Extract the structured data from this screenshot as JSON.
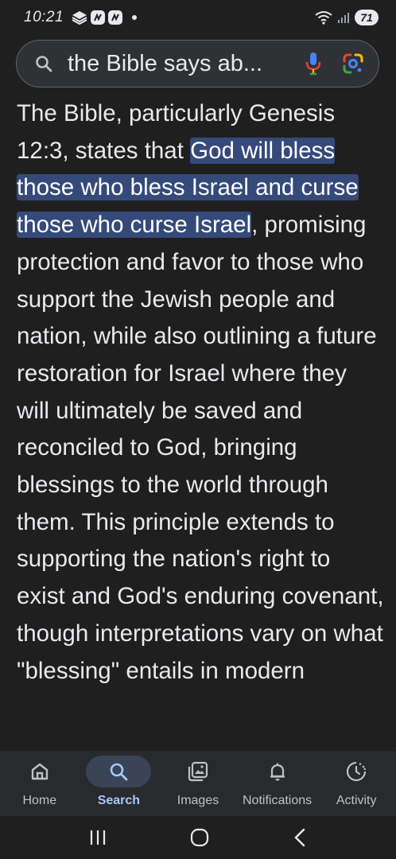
{
  "status_bar": {
    "time": "10:21",
    "battery": "71"
  },
  "search": {
    "query": "the Bible says ab..."
  },
  "answer": {
    "before": "The Bible, particularly Genesis 12:3, states that ",
    "highlight": "God will bless those who bless Israel and curse those who curse Israel",
    "after": ", promising protection and favor to those who support the Jewish people and nation, while also outlining a future restoration for Israel where they will ultimately be saved and reconciled to God, bringing blessings to the world through them. This principle extends to supporting the nation's right to exist and God's enduring covenant, though interpretations vary on what \"blessing\" entails in modern"
  },
  "bottom_nav": {
    "items": [
      {
        "label": "Home",
        "icon": "home-icon"
      },
      {
        "label": "Search",
        "icon": "search-icon",
        "active": true
      },
      {
        "label": "Images",
        "icon": "images-icon"
      },
      {
        "label": "Notifications",
        "icon": "bell-icon"
      },
      {
        "label": "Activity",
        "icon": "activity-icon"
      }
    ]
  },
  "colors": {
    "background": "#1f1f1f",
    "highlight": "#354a7a",
    "active_nav": "#a8c7fa"
  }
}
